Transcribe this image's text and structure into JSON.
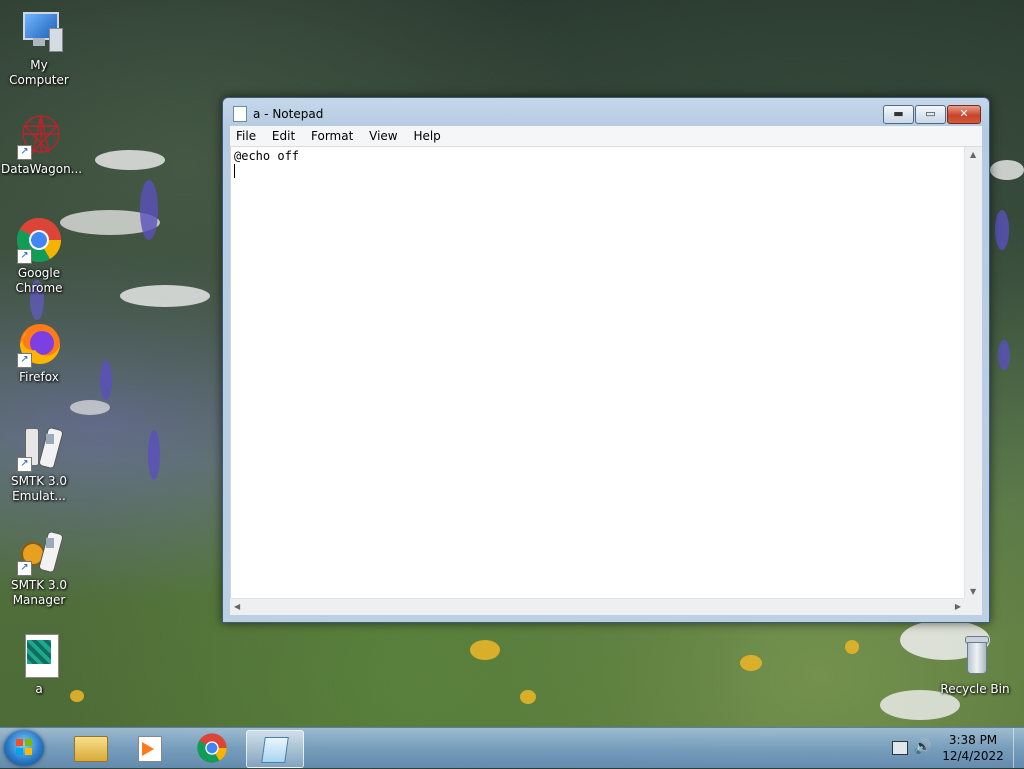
{
  "desktop": {
    "icons": [
      {
        "label": "My Computer"
      },
      {
        "label": "DataWagon..."
      },
      {
        "label": "Google Chrome"
      },
      {
        "label": "Firefox"
      },
      {
        "label": "SMTK 3.0 Emulat..."
      },
      {
        "label": "SMTK 3.0 Manager"
      },
      {
        "label": "a"
      },
      {
        "label": "Recycle Bin"
      }
    ]
  },
  "notepad": {
    "title": "a - Notepad",
    "menu": [
      "File",
      "Edit",
      "Format",
      "View",
      "Help"
    ],
    "content": "@echo off",
    "buttons": {
      "minimize": "▬",
      "maximize": "▭",
      "close": "✕"
    }
  },
  "taskbar": {
    "clock_time": "3:38 PM",
    "clock_date": "12/4/2022",
    "pinned": [
      "start-orb",
      "file-explorer-icon",
      "media-player-icon",
      "chrome-icon",
      "notepad-icon"
    ]
  },
  "colors": {
    "accent": "#2a7bc8",
    "close_red": "#c7442a"
  }
}
